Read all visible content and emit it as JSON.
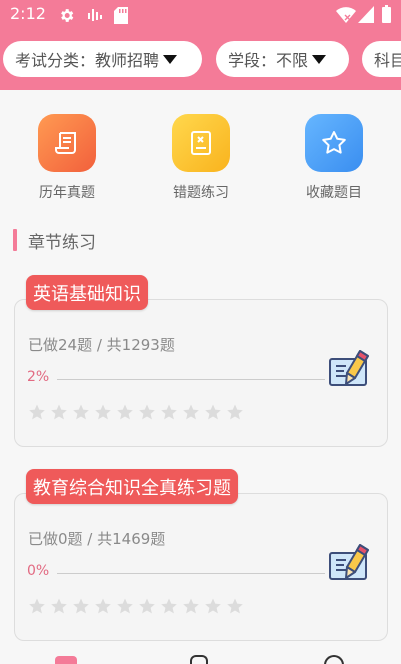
{
  "status_bar": {
    "time": "2:12",
    "left_icons": [
      "gear-icon",
      "signal-bars-icon",
      "sd-card-icon"
    ],
    "right_icons": [
      "wifi-icon",
      "cell-signal-icon",
      "battery-icon"
    ]
  },
  "filters": [
    {
      "label": "考试分类：教师招聘"
    },
    {
      "label": "学段：不限"
    },
    {
      "label": "科目"
    }
  ],
  "shortcuts": [
    {
      "label": "历年真题",
      "icon": "scroll-icon",
      "color": "#f57a47"
    },
    {
      "label": "错题练习",
      "icon": "wrong-answer-icon",
      "color": "#fbc531"
    },
    {
      "label": "收藏题目",
      "icon": "star-icon",
      "color": "#4a9cf5"
    }
  ],
  "section": {
    "title": "章节练习"
  },
  "chapters": [
    {
      "title": "英语基础知识",
      "count_text": "已做24题 / 共1293题",
      "percent_text": "2%",
      "progress": 0.02,
      "stars": 10,
      "filled_stars": 0
    },
    {
      "title": "教育综合知识全真练习题",
      "count_text": "已做0题 / 共1469题",
      "percent_text": "0%",
      "progress": 0,
      "stars": 10,
      "filled_stars": 0
    }
  ],
  "colors": {
    "brand_pink": "#f47b98",
    "tag_red": "#ef5a5a",
    "star_gray": "#dcdcdc"
  }
}
